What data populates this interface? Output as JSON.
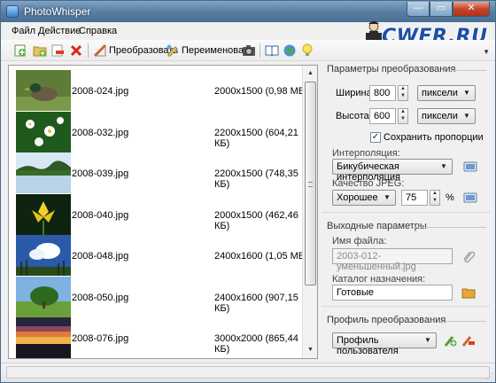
{
  "window": {
    "title": "PhotoWhisper"
  },
  "menu": {
    "file": "Файл",
    "action": "Действие",
    "help": "Справка"
  },
  "logo": {
    "text": "CWER.RU"
  },
  "toolbar": {
    "convert_label": "Преобразовать",
    "rename_label": "Переименовать",
    "icons": [
      "add-files-icon",
      "add-folder-icon",
      "remove-icon",
      "delete-icon",
      "convert-icon",
      "rename-icon",
      "camera-icon",
      "book-icon",
      "globe-icon",
      "bulb-icon"
    ]
  },
  "files": [
    {
      "name": "2008-024.jpg",
      "size": "2000x1500 (0,98 МБ)",
      "thumb": "duck"
    },
    {
      "name": "2008-032.jpg",
      "size": "2200x1500 (604,21 КБ)",
      "thumb": "flowers"
    },
    {
      "name": "2008-039.jpg",
      "size": "2200x1500 (748,35 КБ)",
      "thumb": "lake"
    },
    {
      "name": "2008-040.jpg",
      "size": "2000x1500 (462,46 КБ)",
      "thumb": "iris"
    },
    {
      "name": "2008-048.jpg",
      "size": "2400x1600 (1,05 МБ)",
      "thumb": "clouds"
    },
    {
      "name": "2008-050.jpg",
      "size": "2400x1600 (907,15 КБ)",
      "thumb": "tree"
    },
    {
      "name": "2008-076.jpg",
      "size": "3000x2000 (865,44 КБ)",
      "thumb": "sunset"
    }
  ],
  "conversion": {
    "heading": "Параметры преобразования",
    "width_label": "Ширина:",
    "width_value": "800",
    "height_label": "Высота:",
    "height_value": "600",
    "unit_width": "пиксели",
    "unit_height": "пиксели",
    "keep_ratio_label": "Сохранить пропорции",
    "keep_ratio_checked": true,
    "interp_label": "Интерполяция:",
    "interp_value": "Бикубическая интерполяция",
    "quality_label": "Качество JPEG:",
    "quality_preset": "Хорошее",
    "quality_value": "75",
    "quality_unit": "%"
  },
  "output": {
    "heading": "Выходные параметры",
    "filename_label": "Имя файла:",
    "filename_value": "2003-012-уменьшенный.jpg",
    "folder_label": "Каталог назначения:",
    "folder_value": "Готовые"
  },
  "profile": {
    "heading": "Профиль преобразования",
    "value": "Профиль пользователя"
  },
  "colors": {
    "accent": "#1c4fa8",
    "titlebar": "#5a7fa4",
    "close": "#c4452a"
  }
}
